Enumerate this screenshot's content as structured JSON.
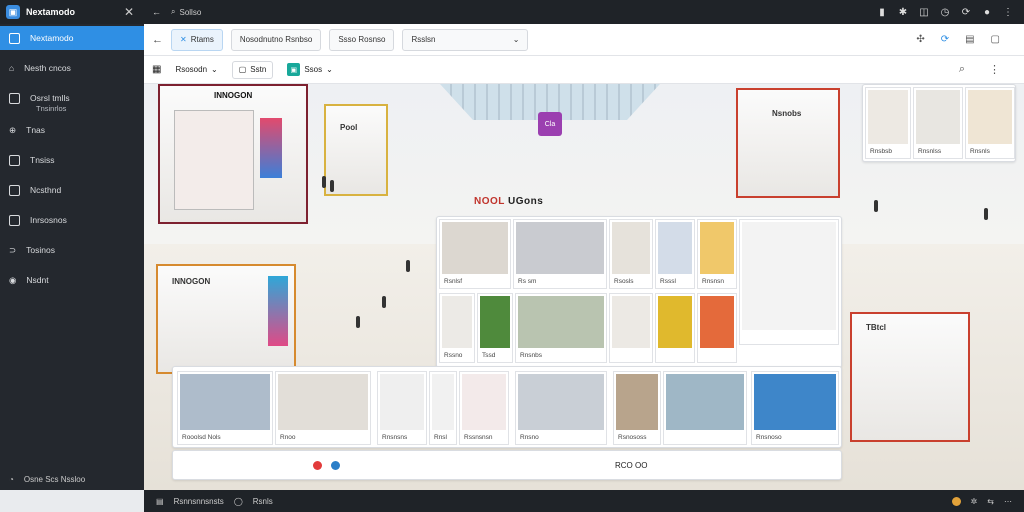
{
  "app": {
    "title": "Nextamodo",
    "close_glyph": "✕"
  },
  "topbar": {
    "back_glyph": "←",
    "search_text": "Sollso",
    "right_icons": [
      "bookmark-icon",
      "puzzle-icon",
      "split-icon",
      "clock-icon",
      "refresh-icon",
      "avatar-icon",
      "more-icon"
    ]
  },
  "sidebar": {
    "items": [
      {
        "label": "Nextamodo",
        "active": true
      },
      {
        "label": "Nesth cncos",
        "active": false
      },
      {
        "label": "Osrsl tmlls",
        "active": false,
        "sub": "Tnsinrlos"
      },
      {
        "label": "Tnas",
        "active": false
      },
      {
        "label": "Tnsiss",
        "active": false
      },
      {
        "label": "Ncsthnd",
        "active": false
      },
      {
        "label": "Inrsosnos",
        "active": false
      },
      {
        "label": "Tosinos",
        "active": false
      },
      {
        "label": "Nsdnt",
        "active": false
      }
    ],
    "bottom_label": "Osne Scs Nssloo"
  },
  "toolbar1": {
    "back_glyph": "←",
    "tabs": [
      {
        "label": "Rtams",
        "selected": true
      },
      {
        "label": "Nosodnutno Rsnbso",
        "selected": false
      },
      {
        "label": "Ssso Rosnso",
        "selected": false
      },
      {
        "label": "Rsslsn",
        "selected": false,
        "dropdown": true
      }
    ]
  },
  "toolbar2": {
    "chips": [
      {
        "label": "Rsosodn",
        "dropdown": true
      },
      {
        "label": "Sstn",
        "dropdown": false
      },
      {
        "label": "Ssos",
        "dropdown": true
      }
    ]
  },
  "scene": {
    "center_sign_a": "NOOL",
    "center_sign_b": "UGons",
    "brand_logo": "Cla",
    "store_signs": [
      "INNOGON",
      "Pool",
      "Nsnobs",
      "INNOGON",
      "TBtcl"
    ],
    "product_labels_mid": [
      "Rsnlsf",
      "Rs sm",
      "Rsosls",
      "Rsssl",
      "Rnsnsn",
      "Rssno",
      "Tssd",
      "Rnsnbs"
    ],
    "product_labels_bottom": [
      "Rooolsd Nols",
      "Rnoo",
      "Rnsnsns",
      "Rnsl",
      "Rssnsnsn",
      "Rnsno",
      "Rsnososs",
      "Rnsnoso"
    ],
    "product_labels_right": [
      "Rnsbsb",
      "Rnsnlss",
      "Rnsnls"
    ],
    "bottom_strip": "RCO OO"
  },
  "statusbar": {
    "items": [
      "Rsnnsnnsnsts",
      "Rsnls"
    ]
  },
  "colors": {
    "accent": "#2f8fe4",
    "dark": "#1f2328",
    "sidebar": "#24282e",
    "store_red": "#7d2130"
  }
}
